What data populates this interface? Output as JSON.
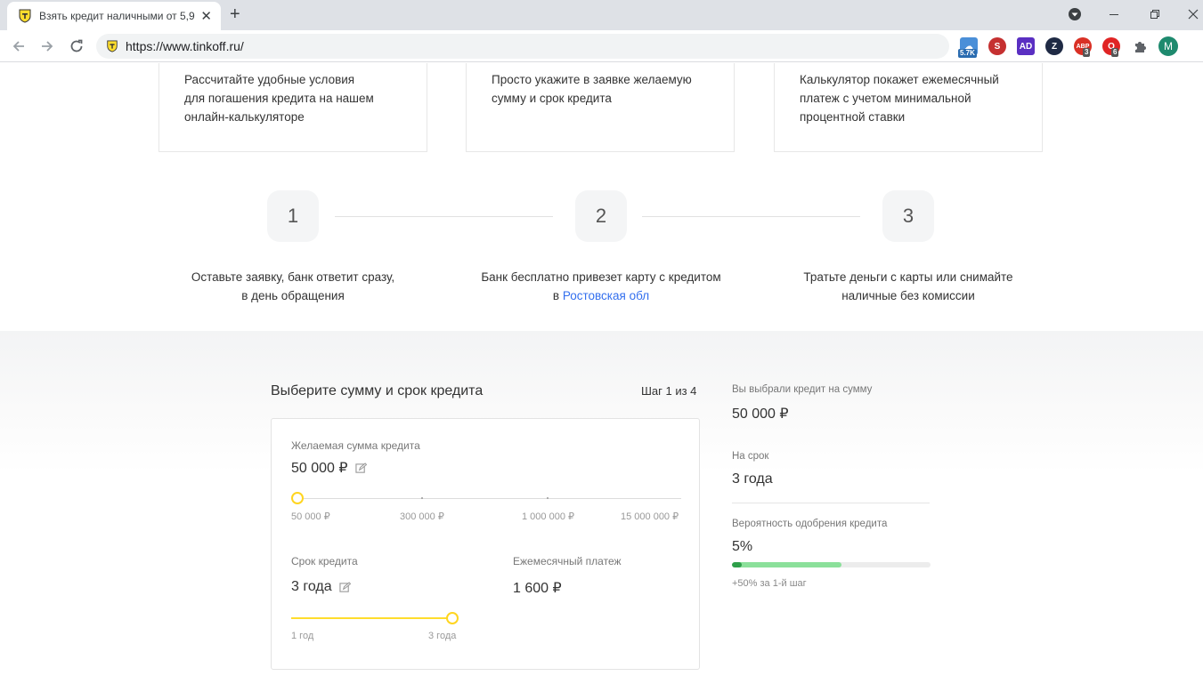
{
  "browser": {
    "tab_title": "Взять кредит наличными от 5,9",
    "url": "https://www.tinkoff.ru/",
    "extensions": [
      {
        "name": "weather-extension",
        "badge": "5.7K"
      },
      {
        "name": "s-extension",
        "badge": ""
      },
      {
        "name": "ad-extension",
        "badge": ""
      },
      {
        "name": "z-extension",
        "badge": ""
      },
      {
        "name": "adblock-extension",
        "badge": "3"
      },
      {
        "name": "opera-extension",
        "badge": "6"
      }
    ],
    "avatar_letter": "M"
  },
  "features": [
    {
      "text": "Рассчитайте удобные условия\nдля погашения кредита на нашем\nонлайн-калькуляторе"
    },
    {
      "text": "Просто укажите в заявке желаемую\nсумму и срок кредита"
    },
    {
      "text": "Калькулятор покажет ежемесячный\nплатеж с учетом минимальной\nпроцентной ставки"
    }
  ],
  "steps": [
    {
      "number": "1",
      "line1": "Оставьте заявку, банк ответит сразу,",
      "line2": "в день обращения"
    },
    {
      "number": "2",
      "line1": "Банк бесплатно привезет карту с кредитом",
      "line2_prefix": "в ",
      "line2_link": "Ростовская обл"
    },
    {
      "number": "3",
      "line1": "Тратьте деньги с карты или снимайте",
      "line2": "наличные без комиссии"
    }
  ],
  "calculator": {
    "title": "Выберите сумму и срок кредита",
    "step_indicator": "Шаг 1 из 4",
    "amount_label": "Желаемая сумма кредита",
    "amount_value": "50 000 ₽",
    "amount_ticks": [
      "50 000 ₽",
      "300 000 ₽",
      "1 000 000 ₽",
      "15 000 000 ₽"
    ],
    "amount_position": 0,
    "term_label": "Срок кредита",
    "term_value": "3 года",
    "term_ticks": [
      "1 год",
      "3 года"
    ],
    "term_position": 1,
    "payment_label": "Ежемесячный платеж",
    "payment_value": "1 600 ₽"
  },
  "summary": {
    "amount_label": "Вы выбрали кредит на сумму",
    "amount_value": "50 000 ₽",
    "term_label": "На срок",
    "term_value": "3 года",
    "approval_label": "Вероятность одобрения кредита",
    "approval_value": "5%",
    "approval_fraction": 0.05,
    "approval_bonus_fraction": 0.5,
    "approval_hint": "+50% за 1-й шаг"
  },
  "colors": {
    "accent_yellow": "#ffdd2d",
    "link_blue": "#336fee",
    "progress_green": "#2e9f4a",
    "progress_light_green": "#8be09a"
  }
}
